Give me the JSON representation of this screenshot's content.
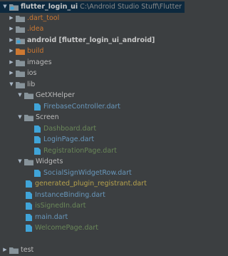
{
  "project": {
    "name": "flutter_login_ui",
    "path": "C:\\Android Studio Stuff\\Flutter Project\\flutter_log"
  },
  "rows": [
    {
      "label": ".dart_tool",
      "color": "#cc7832",
      "icon": "folder-icon"
    },
    {
      "label": ".idea",
      "color": "#cc7832",
      "icon": "folder-icon"
    },
    {
      "label": "android [flutter_login_ui_android]",
      "color": "#c8c8c8",
      "icon": "android-module-folder-icon"
    },
    {
      "label": "build",
      "color": "#cc7832",
      "icon": "excluded-folder-icon"
    },
    {
      "label": "images",
      "color": "#bbbbbb",
      "icon": "folder-icon"
    },
    {
      "label": "ios",
      "color": "#bbbbbb",
      "icon": "folder-icon"
    },
    {
      "label": "lib",
      "color": "#bbbbbb",
      "icon": "folder-icon"
    },
    {
      "label": "GetXHelper",
      "color": "#bbbbbb",
      "icon": "folder-icon"
    },
    {
      "label": "FirebaseController.dart",
      "color": "#6897bb",
      "icon": "dart-file-icon"
    },
    {
      "label": "Screen",
      "color": "#bbbbbb",
      "icon": "folder-icon"
    },
    {
      "label": "Dashboard.dart",
      "color": "#6a8759",
      "icon": "dart-file-icon"
    },
    {
      "label": "LoginPage.dart",
      "color": "#6897bb",
      "icon": "dart-file-icon"
    },
    {
      "label": "RegistrationPage.dart",
      "color": "#6a8759",
      "icon": "dart-file-icon"
    },
    {
      "label": "Widgets",
      "color": "#bbbbbb",
      "icon": "folder-icon"
    },
    {
      "label": "SocialSignWidgetRow.dart",
      "color": "#6897bb",
      "icon": "dart-file-icon"
    },
    {
      "label": "generated_plugin_registrant.dart",
      "color": "#b5a14d",
      "icon": "dart-file-icon"
    },
    {
      "label": "InstanceBinding.dart",
      "color": "#6897bb",
      "icon": "dart-file-icon"
    },
    {
      "label": "isSignedIn.dart",
      "color": "#6a8759",
      "icon": "dart-file-icon"
    },
    {
      "label": "main.dart",
      "color": "#6897bb",
      "icon": "dart-file-icon"
    },
    {
      "label": "WelcomePage.dart",
      "color": "#6a8759",
      "icon": "dart-file-icon"
    },
    {
      "label": "",
      "color": "#bbbbbb",
      "icon": ""
    },
    {
      "label": "test",
      "color": "#bbbbbb",
      "icon": "folder-icon"
    }
  ],
  "colors": {
    "background": "#3c3f41",
    "selection": "#0d293e",
    "folder": "#87939a",
    "excluded_folder": "#cc7832",
    "dart_icon": "#40a4d8"
  }
}
